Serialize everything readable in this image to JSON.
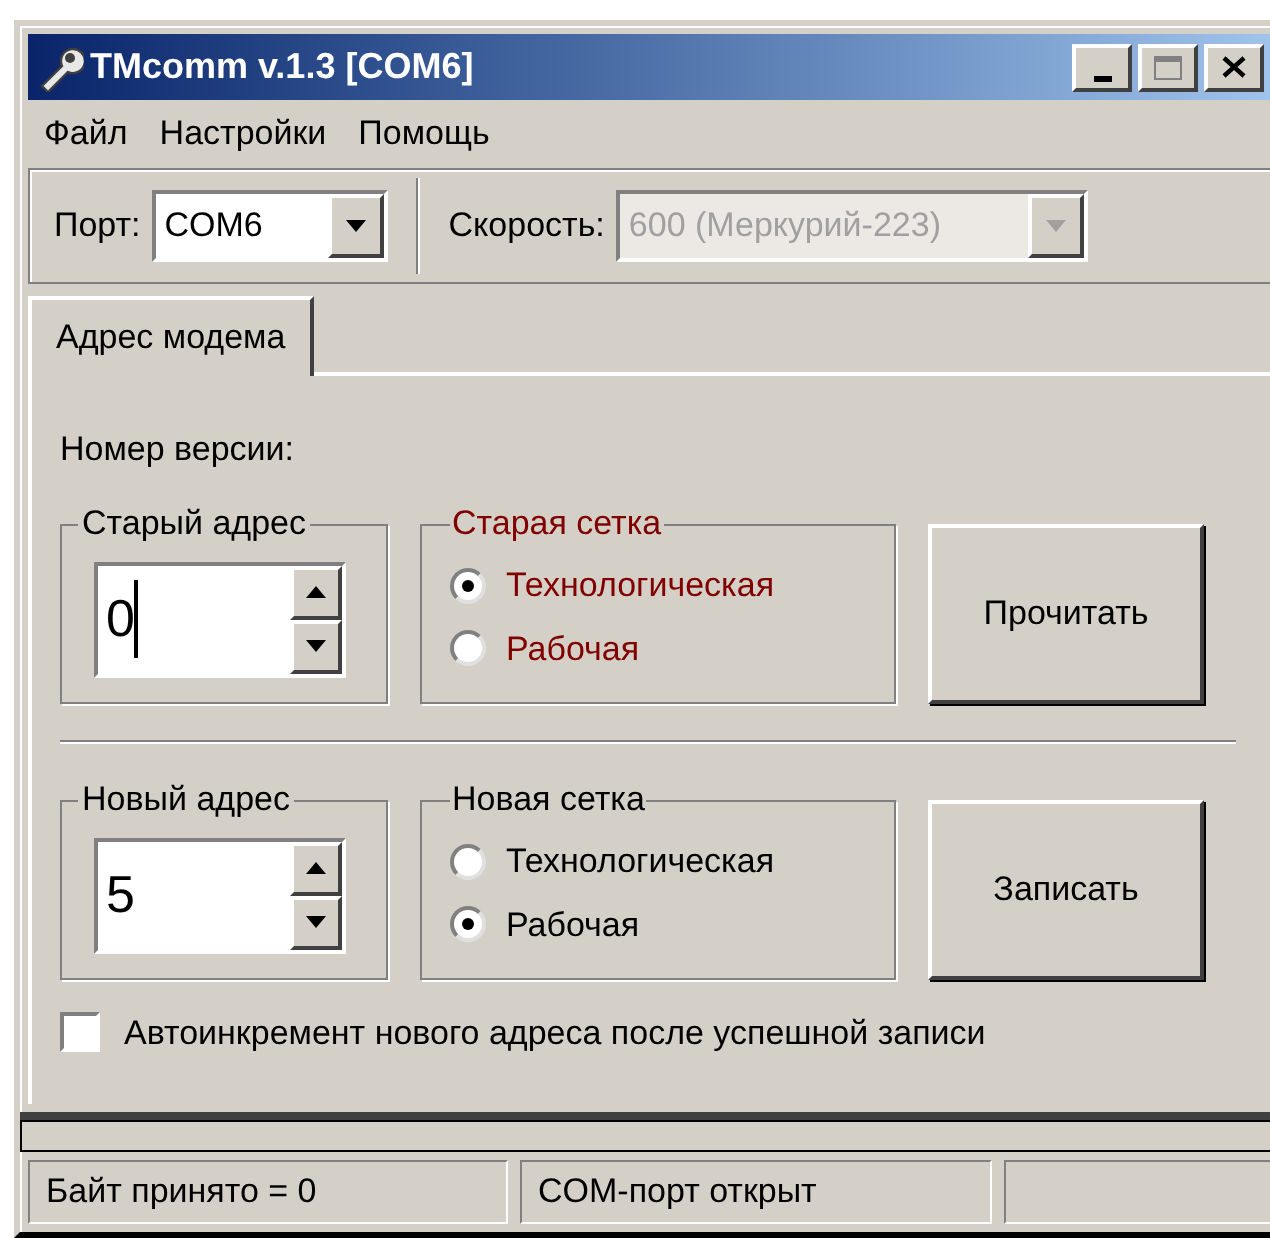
{
  "window": {
    "title": "TMcomm v.1.3 [COM6]"
  },
  "menu": [
    {
      "label": "Файл"
    },
    {
      "label": "Настройки"
    },
    {
      "label": "Помощь"
    }
  ],
  "toolbar": {
    "port": {
      "label": "Порт:",
      "value": "COM6",
      "disabled": false
    },
    "speed": {
      "label": "Скорость:",
      "value": "600  (Меркурий-223)",
      "disabled": true
    }
  },
  "tabs": [
    {
      "label": "Адрес модема",
      "selected": true
    }
  ],
  "version_label": "Номер версии:",
  "sections": [
    {
      "address": {
        "label": "Старый адрес",
        "value": "0",
        "focused": true
      },
      "grid": {
        "label": "Старая сетка",
        "highlighted": true,
        "options": [
          {
            "label": "Технологическая",
            "selected": true
          },
          {
            "label": "Рабочая",
            "selected": false
          }
        ]
      },
      "button": "Прочитать"
    },
    {
      "address": {
        "label": "Новый адрес",
        "value": "5",
        "focused": false
      },
      "grid": {
        "label": "Новая сетка",
        "highlighted": false,
        "options": [
          {
            "label": "Технологическая",
            "selected": false
          },
          {
            "label": "Рабочая",
            "selected": true
          }
        ]
      },
      "button": "Записать"
    }
  ],
  "autoincrement": {
    "label": "Автоинкремент нового адреса после успешной записи",
    "checked": false
  },
  "progress": {
    "level": 0
  },
  "status_bar": [
    "Байт принято = 0",
    "COM-порт открыт"
  ]
}
